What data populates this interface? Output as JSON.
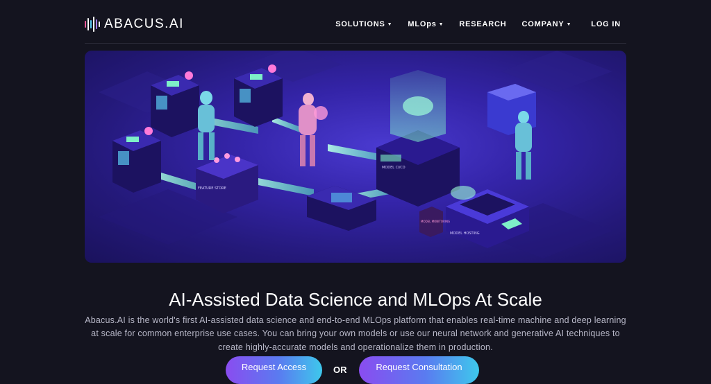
{
  "brand": {
    "name": "ABACUS.AI"
  },
  "nav": {
    "items": [
      {
        "label": "SOLUTIONS",
        "has_dropdown": true
      },
      {
        "label": "MLOps",
        "has_dropdown": true
      },
      {
        "label": "RESEARCH",
        "has_dropdown": false
      },
      {
        "label": "COMPANY",
        "has_dropdown": true
      }
    ],
    "login_label": "LOG IN"
  },
  "hero": {
    "illustration_labels": {
      "feature_store": "FEATURE STORE",
      "model_ci_cd": "MODEL CI/CD",
      "model_hosting": "MODEL HOSTING",
      "model_monitoring": "MODEL MONITORING"
    }
  },
  "main": {
    "heading": "AI-Assisted Data Science and MLOps At Scale",
    "description": "Abacus.AI is the world's first AI-assisted data science and end-to-end MLOps platform that enables real-time machine and deep learning at scale for common enterprise use cases. You can bring your own models or use our neural network and generative AI techniques to create highly-accurate models and operationalize them in production.",
    "cta_primary": "Request Access",
    "cta_separator": "OR",
    "cta_secondary": "Request Consultation"
  },
  "colors": {
    "background": "#14141f",
    "hero_base": "#3424a8",
    "accent_cyan": "#3ec8ec",
    "accent_purple": "#8a4cf0",
    "accent_pink": "#ff7ad9",
    "glow_green": "#7ef0c8"
  },
  "icons": {
    "caret": "chevron-down-icon",
    "logo": "abacus-logo-icon"
  }
}
